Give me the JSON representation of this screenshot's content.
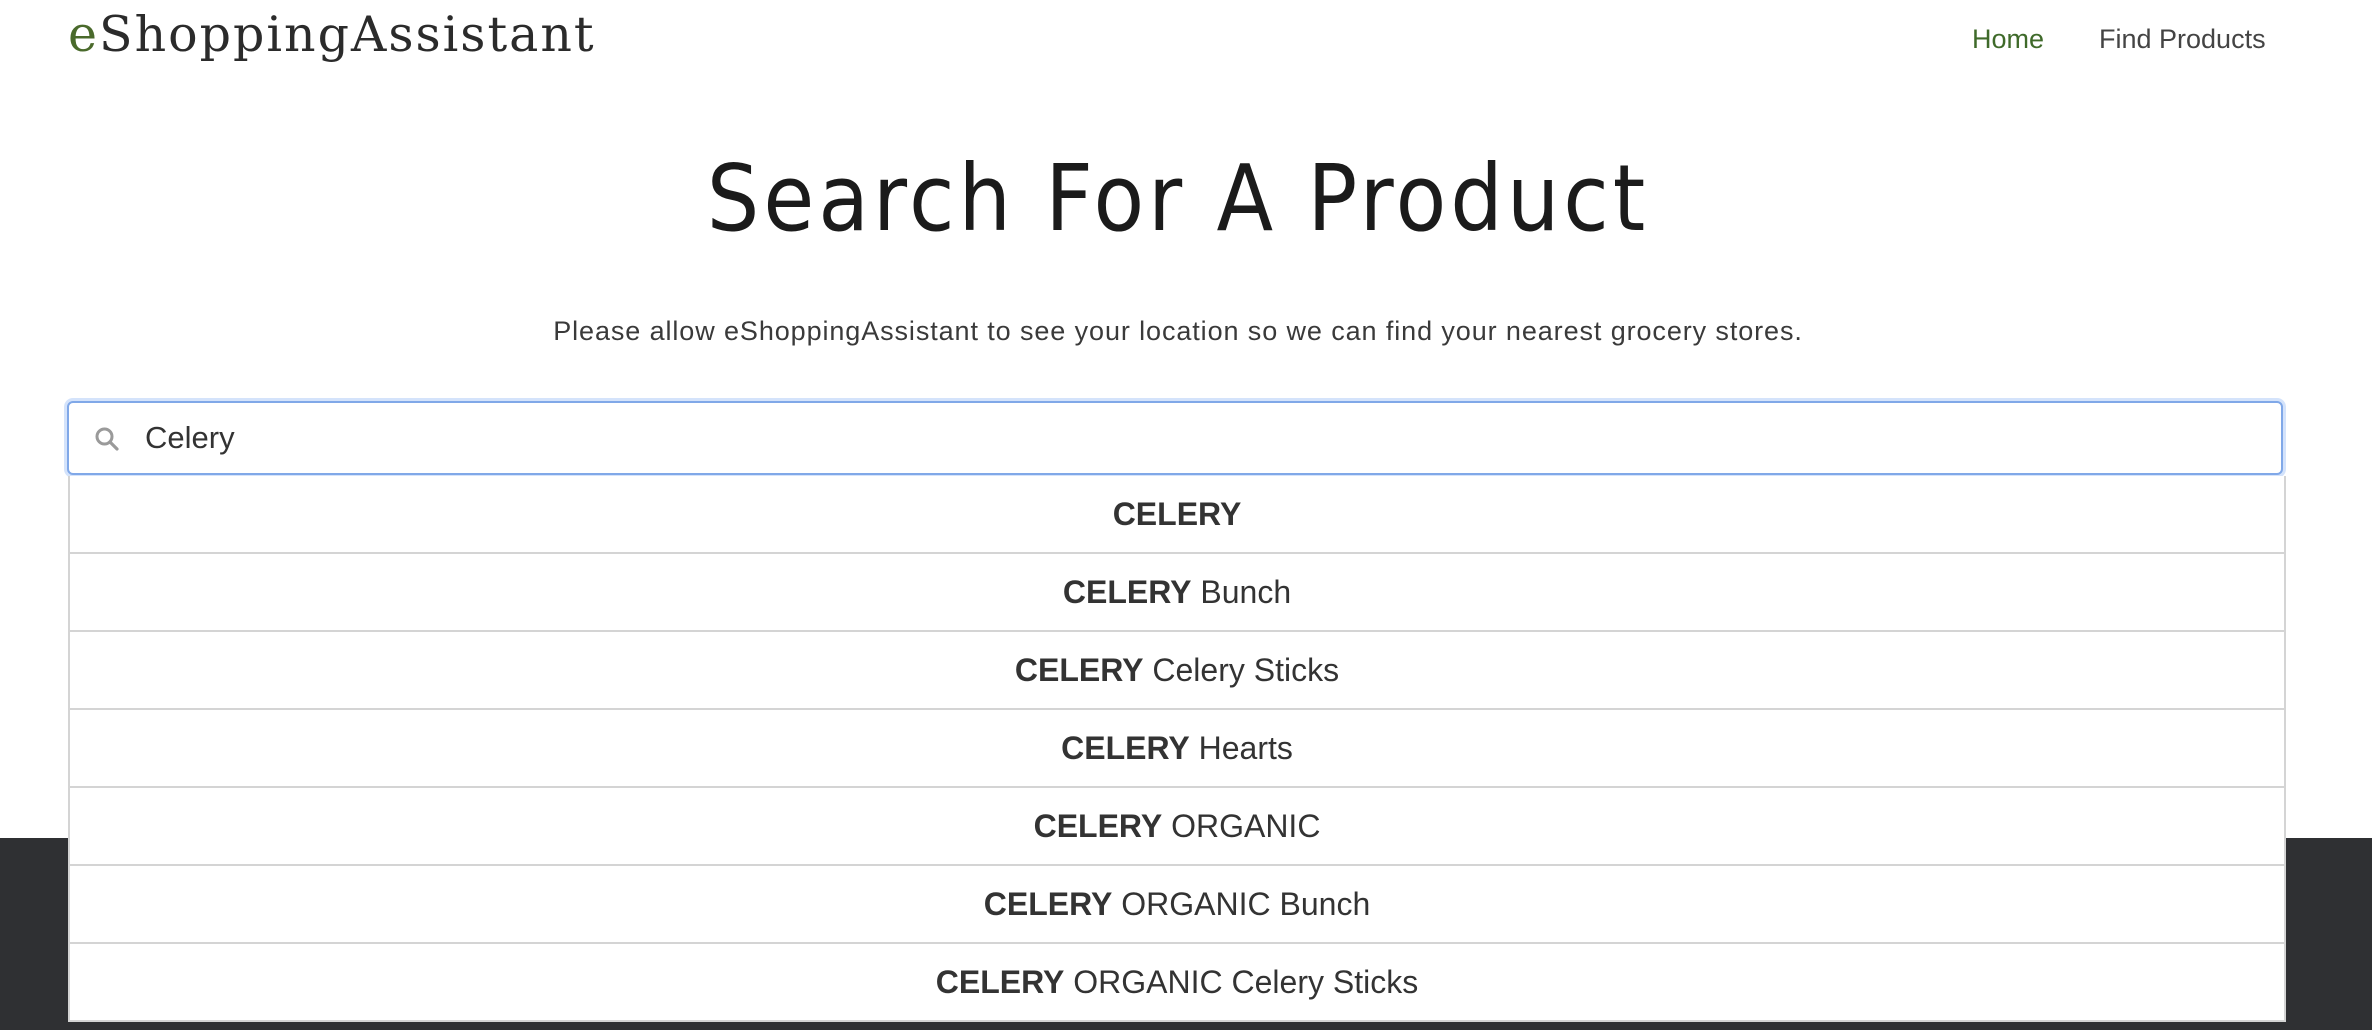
{
  "header": {
    "logo_first": "e",
    "logo_rest": "ShoppingAssistant",
    "nav": [
      {
        "label": "Home"
      },
      {
        "label": "Find Products"
      }
    ]
  },
  "main": {
    "title": "Search For A Product",
    "subtitle": "Please allow eShoppingAssistant to see your location so we can find your nearest grocery stores."
  },
  "search": {
    "value": "Celery",
    "icon": "search-icon"
  },
  "suggestions": [
    {
      "match": "CELERY",
      "rest": ""
    },
    {
      "match": "CELERY",
      "rest": " Bunch"
    },
    {
      "match": "CELERY",
      "rest": " Celery Sticks"
    },
    {
      "match": "CELERY",
      "rest": " Hearts"
    },
    {
      "match": "CELERY",
      "rest": " ORGANIC"
    },
    {
      "match": "CELERY",
      "rest": " ORGANIC Bunch"
    },
    {
      "match": "CELERY",
      "rest": " ORGANIC Celery Sticks"
    }
  ],
  "colors": {
    "brand_green": "#3f6a2a",
    "focus_border": "#80a8e8",
    "footer_band": "#2f3033"
  }
}
